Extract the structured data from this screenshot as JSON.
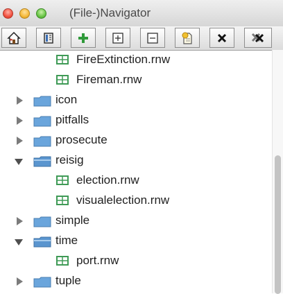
{
  "window": {
    "title": "(File-)Navigator"
  },
  "toolbar": {
    "buttons": [
      {
        "icon": "home-icon"
      },
      {
        "icon": "book-icon"
      },
      {
        "icon": "plus-icon"
      },
      {
        "icon": "expand-all-icon"
      },
      {
        "icon": "collapse-all-icon"
      },
      {
        "icon": "document-star-icon"
      },
      {
        "icon": "close-x-icon"
      },
      {
        "icon": "close-all-icon"
      }
    ]
  },
  "tree": {
    "items": [
      {
        "label": "FireExtinction.rnw",
        "type": "file"
      },
      {
        "label": "Fireman.rnw",
        "type": "file"
      },
      {
        "label": "icon",
        "type": "folder",
        "expanded": false
      },
      {
        "label": "pitfalls",
        "type": "folder",
        "expanded": false
      },
      {
        "label": "prosecute",
        "type": "folder",
        "expanded": false
      },
      {
        "label": "reisig",
        "type": "folder",
        "expanded": true
      },
      {
        "label": "election.rnw",
        "type": "file"
      },
      {
        "label": "visualelection.rnw",
        "type": "file"
      },
      {
        "label": "simple",
        "type": "folder",
        "expanded": false
      },
      {
        "label": "time",
        "type": "folder",
        "expanded": true
      },
      {
        "label": "port.rnw",
        "type": "file"
      },
      {
        "label": "tuple",
        "type": "folder",
        "expanded": false
      }
    ]
  },
  "colors": {
    "folder": "#6aa5dc",
    "file_icon": "#3f9a56",
    "accent_plus": "#2f9a3a"
  }
}
